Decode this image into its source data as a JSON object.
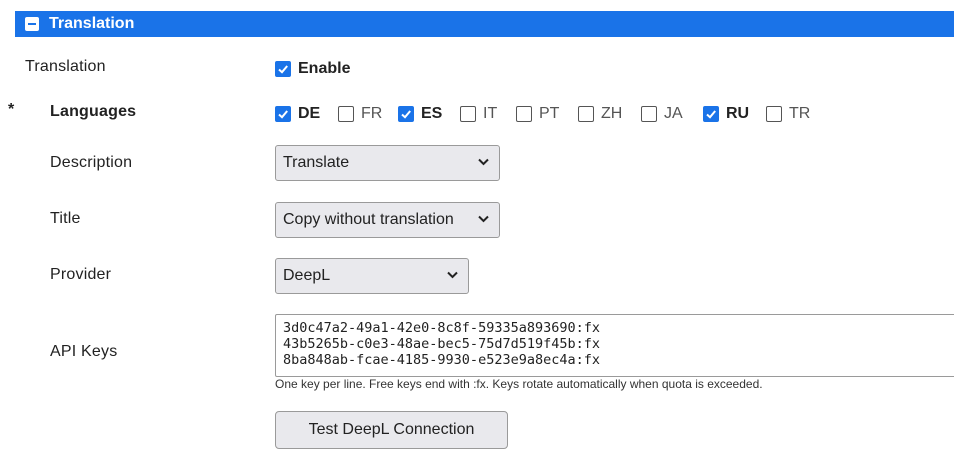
{
  "section": {
    "title": "Translation",
    "collapse_icon": "minus-square-icon"
  },
  "translation": {
    "label": "Translation",
    "enable_label": "Enable",
    "enabled": true
  },
  "languages": {
    "label": "Languages",
    "required_marker": "*",
    "items": [
      {
        "code": "DE",
        "checked": true
      },
      {
        "code": "FR",
        "checked": false
      },
      {
        "code": "ES",
        "checked": true
      },
      {
        "code": "IT",
        "checked": false
      },
      {
        "code": "PT",
        "checked": false
      },
      {
        "code": "ZH",
        "checked": false
      },
      {
        "code": "JA",
        "checked": false
      },
      {
        "code": "RU",
        "checked": true
      },
      {
        "code": "TR",
        "checked": false
      }
    ]
  },
  "description": {
    "label": "Description",
    "value": "Translate"
  },
  "title": {
    "label": "Title",
    "value": "Copy without translation"
  },
  "provider": {
    "label": "Provider",
    "value": "DeepL"
  },
  "api_keys": {
    "label": "API Keys",
    "value": "3d0c47a2-49a1-42e0-8c8f-59335a893690:fx\n43b5265b-c0e3-48ae-bec5-75d7d519f45b:fx\n8ba848ab-fcae-4185-9930-e523e9a8ec4a:fx",
    "hint": "One key per line. Free keys end with :fx. Keys rotate automatically when quota is exceeded."
  },
  "test_button": {
    "label": "Test DeepL Connection"
  },
  "colors": {
    "accent": "#1a73e8"
  }
}
